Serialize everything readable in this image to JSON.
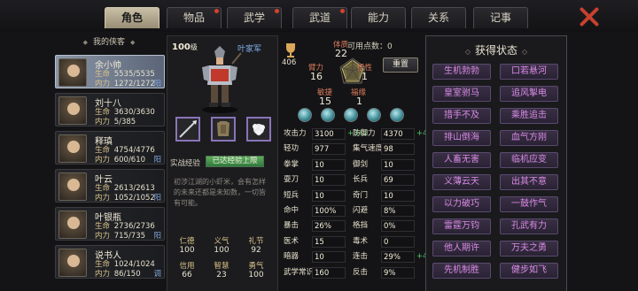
{
  "tabs": [
    {
      "label": "角色",
      "active": true,
      "dot": false
    },
    {
      "label": "物品",
      "active": false,
      "dot": true
    },
    {
      "label": "武学",
      "active": false,
      "dot": true
    },
    {
      "label": "武道",
      "active": false,
      "dot": true
    },
    {
      "label": "能力",
      "active": false,
      "dot": false
    },
    {
      "label": "关系",
      "active": false,
      "dot": false
    },
    {
      "label": "记事",
      "active": false,
      "dot": false
    }
  ],
  "roster": {
    "title": "我的侠客",
    "hp_key": "生命",
    "mp_key": "内力",
    "heroes": [
      {
        "name": "余小帅",
        "hp": "5535/5535",
        "mp": "1272/1272",
        "tag": "阳"
      },
      {
        "name": "刘十八",
        "hp": "3630/3630",
        "mp": "5/385",
        "tag": ""
      },
      {
        "name": "释瑱",
        "hp": "4754/4776",
        "mp": "600/610",
        "tag": "阳"
      },
      {
        "name": "叶云",
        "hp": "2613/2613",
        "mp": "1052/1052",
        "tag": "阳"
      },
      {
        "name": "叶银瓶",
        "hp": "2736/2736",
        "mp": "715/735",
        "tag": "阳"
      },
      {
        "name": "说书人",
        "hp": "1024/1024",
        "mp": "86/150",
        "tag": "调"
      }
    ]
  },
  "character": {
    "level": "100",
    "level_unit": "级",
    "sect": "叶家军",
    "exp_label": "实战经验",
    "exp_text": "已达经验上限",
    "exp_fraction": 1.0,
    "bio": "初涉江湖的小虾米，会有怎样的未来还都是未知数，一切皆有可能。",
    "virtues": [
      {
        "k": "仁德",
        "v": "100"
      },
      {
        "k": "义气",
        "v": "100"
      },
      {
        "k": "礼节",
        "v": "92"
      },
      {
        "k": "信用",
        "v": "66"
      },
      {
        "k": "智慧",
        "v": "23"
      },
      {
        "k": "勇气",
        "v": "100"
      }
    ]
  },
  "attributes": {
    "points": "406",
    "free_points_label": "可用点数：0",
    "reset_label": "重置",
    "constitution": {
      "k": "体质",
      "v": "22"
    },
    "strength": {
      "k": "臂力",
      "v": "16"
    },
    "insight": {
      "k": "悟性",
      "v": "1"
    },
    "agility": {
      "k": "敏捷",
      "v": "15"
    },
    "fortune": {
      "k": "福缘",
      "v": "1"
    }
  },
  "stats_left": [
    {
      "k": "攻击力",
      "v": "3100",
      "b": "+342"
    },
    {
      "k": "轻功",
      "v": "977",
      "b": ""
    },
    {
      "k": "拳掌",
      "v": "10",
      "b": ""
    },
    {
      "k": "耍刀",
      "v": "10",
      "b": ""
    },
    {
      "k": "短兵",
      "v": "10",
      "b": ""
    },
    {
      "k": "命中",
      "v": "100%",
      "b": ""
    },
    {
      "k": "暴击",
      "v": "26%",
      "b": ""
    },
    {
      "k": "医术",
      "v": "15",
      "b": ""
    },
    {
      "k": "暗器",
      "v": "10",
      "b": ""
    },
    {
      "k": "武学常识",
      "v": "160",
      "b": ""
    }
  ],
  "stats_right": [
    {
      "k": "防御力",
      "v": "4370",
      "b": "+426"
    },
    {
      "k": "集气速度",
      "v": "98",
      "b": ""
    },
    {
      "k": "御剑",
      "v": "10",
      "b": ""
    },
    {
      "k": "长兵",
      "v": "69",
      "b": ""
    },
    {
      "k": "奇门",
      "v": "10",
      "b": ""
    },
    {
      "k": "闪避",
      "v": "8%",
      "b": ""
    },
    {
      "k": "格挡",
      "v": "0%",
      "b": ""
    },
    {
      "k": "毒术",
      "v": "0",
      "b": ""
    },
    {
      "k": "连击",
      "v": "29%",
      "b": "+4%"
    },
    {
      "k": "反击",
      "v": "9%",
      "b": ""
    }
  ],
  "buffs": {
    "title": "获得状态",
    "items": [
      "生机勃勃",
      "口若悬河",
      "皇室驸马",
      "追风掣电",
      "措手不及",
      "乘胜追击",
      "排山倒海",
      "血气方刚",
      "人畜无害",
      "临机应变",
      "义薄云天",
      "出其不意",
      "以力破巧",
      "一鼓作气",
      "雷霆万钧",
      "孔武有力",
      "他人期许",
      "万夫之勇",
      "先机制胜",
      "健步如飞"
    ]
  },
  "colors": {
    "accent": "#c9bfa6",
    "buff_text": "#d98be6",
    "bonus": "#4fc86a",
    "close": "#c7412f"
  }
}
